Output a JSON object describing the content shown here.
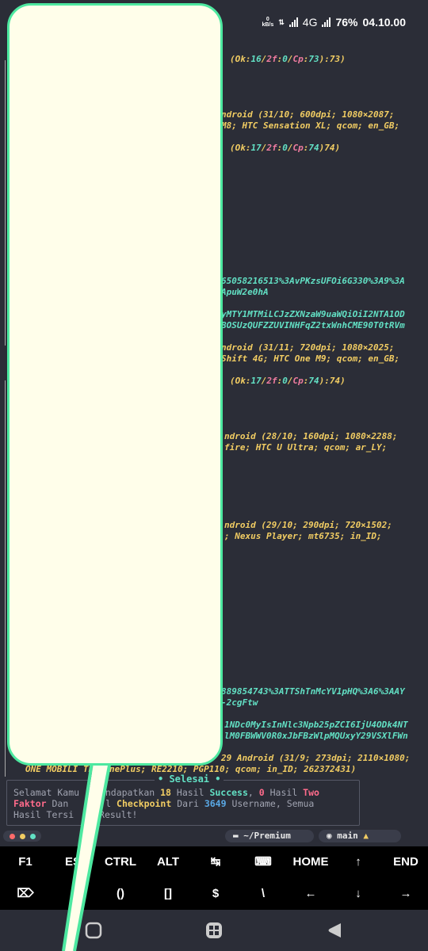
{
  "status_bar": {
    "speed_value": "0",
    "speed_unit": "kB/s",
    "network": "4G",
    "battery": "76%",
    "time": "04.10.00"
  },
  "terminal": {
    "lines": [
      {
        "segments": [
          {
            "t": "(Ok:",
            "c": "y"
          },
          {
            "t": "16",
            "c": "c"
          },
          {
            "t": "/",
            "c": "y"
          },
          {
            "t": "2f",
            "c": "p"
          },
          {
            "t": ":",
            "c": "y"
          },
          {
            "t": "0",
            "c": "c"
          },
          {
            "t": "/",
            "c": "y"
          },
          {
            "t": "Cp",
            "c": "p"
          },
          {
            "t": ":",
            "c": "y"
          },
          {
            "t": "73",
            "c": "c"
          },
          {
            "t": "):73)",
            "c": "y"
          }
        ]
      },
      {
        "segments": [
          {
            "t": "ndroid (31/10; 600dpi; 1080×2087;",
            "c": "y"
          }
        ]
      },
      {
        "segments": [
          {
            "t": "M8; HTC Sensation XL; qcom; en_GB;",
            "c": "y"
          }
        ]
      },
      {
        "segments": [
          {
            "t": "(Ok:",
            "c": "y"
          },
          {
            "t": "17",
            "c": "c"
          },
          {
            "t": "/",
            "c": "y"
          },
          {
            "t": "2f",
            "c": "p"
          },
          {
            "t": ":",
            "c": "y"
          },
          {
            "t": "0",
            "c": "c"
          },
          {
            "t": "/",
            "c": "y"
          },
          {
            "t": "Cp",
            "c": "p"
          },
          {
            "t": ":",
            "c": "y"
          },
          {
            "t": "74",
            "c": "c"
          },
          {
            "t": ")74)",
            "c": "y"
          }
        ]
      },
      {
        "segments": [
          {
            "t": "65058216513%3AvPKzsUFOi6G330%3A9%3A",
            "c": "c"
          }
        ]
      },
      {
        "segments": [
          {
            "t": "ApuW2e0hA",
            "c": "c"
          }
        ]
      },
      {
        "segments": [
          {
            "t": "yMTY1MTMiLCJzZXNzaW9uaWQiOiI2NTA1OD",
            "c": "c"
          }
        ]
      },
      {
        "segments": [
          {
            "t": "BOSUzQUFZZUVINHFqZ2txWnhCME90T0tRVm",
            "c": "c"
          }
        ]
      },
      {
        "segments": [
          {
            "t": "ndroid (31/11; 720dpi; 1080×2025;",
            "c": "y"
          }
        ]
      },
      {
        "segments": [
          {
            "t": "Shift 4G; HTC One M9; qcom; en_GB;",
            "c": "y"
          }
        ]
      },
      {
        "segments": [
          {
            "t": "(Ok:",
            "c": "y"
          },
          {
            "t": "17",
            "c": "c"
          },
          {
            "t": "/",
            "c": "y"
          },
          {
            "t": "2f",
            "c": "p"
          },
          {
            "t": ":",
            "c": "y"
          },
          {
            "t": "0",
            "c": "c"
          },
          {
            "t": "/",
            "c": "y"
          },
          {
            "t": "Cp",
            "c": "p"
          },
          {
            "t": ":",
            "c": "y"
          },
          {
            "t": "74",
            "c": "c"
          },
          {
            "t": "):74)",
            "c": "y"
          }
        ]
      },
      {
        "segments": [
          {
            "t": "ndroid (28/10; 160dpi; 1080×2288;",
            "c": "y"
          }
        ]
      },
      {
        "segments": [
          {
            "t": "fire; HTC U Ultra; qcom; ar_LY;",
            "c": "y"
          }
        ]
      },
      {
        "segments": [
          {
            "t": "ndroid (29/10; 290dpi; 720×1502;",
            "c": "y"
          }
        ]
      },
      {
        "segments": [
          {
            "t": "; Nexus Player; mt6735; in_ID;",
            "c": "y"
          }
        ]
      },
      {
        "segments": [
          {
            "t": "889854743%3ATTShTnMcYV1pHQ%3A6%3AAY",
            "c": "c"
          }
        ]
      },
      {
        "segments": [
          {
            "t": "-2cgFtw",
            "c": "c"
          }
        ]
      },
      {
        "segments": [
          {
            "t": "1NDc0MyIsInNlc3Npb25pZCI6IjU4ODk4NT",
            "c": "c"
          }
        ]
      },
      {
        "segments": [
          {
            "t": "lM0FBWWV0R0xJbFBzWlpMQUxyY29VSXlFWn",
            "c": "c"
          }
        ]
      },
      {
        "segments": [
          {
            "t": "29 Android (31/9; 273dpi; 2110×1080;",
            "c": "y"
          }
        ]
      },
      {
        "segments": [
          {
            "t": "ONE MOBILI",
            "c": "y"
          },
          {
            "t": "        ",
            "c": "y"
          },
          {
            "t": "TED/OnePlus; RE2210; PGP110; qcom; in_ID; 262372431)",
            "c": "y"
          }
        ]
      }
    ]
  },
  "result_box": {
    "title": "• Selesai •",
    "text_1": "Selamat Kamu",
    "text_2": " Mendapatkan ",
    "success_count": "18",
    "text_3": " Hasil ",
    "success_label": "Success",
    "text_4": ", ",
    "twofactor_count": "0",
    "text_5": " Hasil ",
    "twofactor_label_1": "Two",
    "twofactor_label_2": "Faktor",
    "text_6": " Dan ",
    "text_7": "l ",
    "checkpoint_label": "Checkpoint",
    "text_8": " Dari ",
    "username_count": "3649",
    "text_9": " Username, Semua",
    "text_10": "Hasil Tersi",
    "text_11": "i Result!"
  },
  "tab_bar": {
    "path": "~/Premium",
    "branch": "main",
    "warning": "▲"
  },
  "extra_keys": {
    "row1": [
      "F1",
      "ES",
      "CTRL",
      "ALT",
      "↹",
      "⌨",
      "HOME",
      "↑",
      "END"
    ],
    "row2": [
      "⌦",
      "",
      "()",
      "[]",
      "$",
      "\\",
      "←",
      "↓",
      "→"
    ]
  },
  "colors": {
    "terminal_bg": "#2b2d37",
    "yellow": "#f2cd63",
    "cyan": "#62e0c4",
    "pink": "#f07ca0",
    "bubble_fill": "#fffeea",
    "bubble_border": "#4de8a0"
  }
}
